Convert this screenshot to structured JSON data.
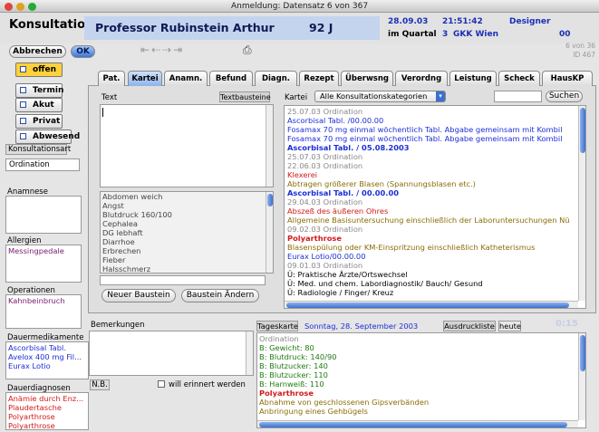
{
  "window": {
    "title": "Anmeldung: Datensatz 6 von 367"
  },
  "header": {
    "title": "Konsultation",
    "patient_name": "Professor Rubinstein Arthur",
    "age": "92 J",
    "date": "28.09.03",
    "time": "21:51:42",
    "user": "Designer",
    "quarter_label": "im Quartal",
    "quarter": "3",
    "insurance": "GKK Wien",
    "code": "00",
    "record_count": "6 von 36",
    "id_label": "ID 467"
  },
  "toolbar": {
    "cancel": "Abbrechen",
    "ok": "OK"
  },
  "sidebar": {
    "offen": "offen",
    "termin": "Termin",
    "akut": "Akut",
    "privat": "Privat",
    "abwesend": "Abwesend",
    "konsultationsart_label": "Konsultationsart",
    "konsultationsart_value": "Ordination"
  },
  "anamnese": {
    "label": "Anamnese"
  },
  "allergien": {
    "label": "Allergien",
    "items": [
      "Messingpedale"
    ]
  },
  "operationen": {
    "label": "Operationen",
    "items": [
      "Kahnbeinbruch"
    ]
  },
  "dauermedikamente": {
    "label": "Dauermedikamente",
    "items": [
      "Ascorbisal Tabl.",
      "Avelox 400 mg Fil...",
      "Eurax Lotio"
    ]
  },
  "dauerdiagnosen": {
    "label": "Dauerdiagnosen",
    "items": [
      "Anämie durch Enz...",
      "Plaudertasche",
      "Polyarthrose",
      "Polyarthrose"
    ]
  },
  "tabs": [
    "Pat.",
    "Kartei",
    "Anamn.",
    "Befund",
    "Diagn.",
    "Rezept",
    "Überwsng",
    "Verordng",
    "Leistung",
    "Scheck",
    "HausKP"
  ],
  "text_panel": {
    "label": "Text",
    "bausteine_button": "Textbausteine"
  },
  "bausteine": {
    "items": [
      "Abdomen weich",
      "Angst",
      "Blutdruck 160/100",
      "Cephalea",
      "DG lebhaft",
      "Diarrhoe",
      "Erbrechen",
      "Fieber",
      "Halsschmerz"
    ],
    "new_button": "Neuer Baustein",
    "change_button": "Baustein Ändern"
  },
  "kartei": {
    "label": "Kartei",
    "filter": "Alle Konsultationskategorien",
    "search_button": "Suchen",
    "entries": [
      {
        "text": "25.07.03  Ordination",
        "c": "gray",
        "b": false
      },
      {
        "text": "Ascorbisal Tabl. /00.00.00",
        "c": "blue",
        "b": false
      },
      {
        "text": "Fosamax 70 mg einmal wöchentlich Tabl. Abgabe gemeinsam mit Kombil",
        "c": "blue",
        "b": false
      },
      {
        "text": "Fosamax 70 mg einmal wöchentlich Tabl. Abgabe gemeinsam mit Kombil",
        "c": "blue",
        "b": false
      },
      {
        "text": "Ascorbisal Tabl. / 05.08.2003",
        "c": "blue",
        "b": true
      },
      {
        "text": "25.07.03  Ordination",
        "c": "gray",
        "b": false
      },
      {
        "text": "22.06.03  Ordination",
        "c": "gray",
        "b": false
      },
      {
        "text": "Klexerei",
        "c": "red",
        "b": false
      },
      {
        "text": "Abtragen größerer Blasen (Spannungsblasen etc.)",
        "c": "olive",
        "b": false
      },
      {
        "text": "Ascorbisal Tabl. / 00.00.00",
        "c": "blue",
        "b": true
      },
      {
        "text": "29.04.03  Ordination",
        "c": "gray",
        "b": false
      },
      {
        "text": "Abszeß des äußeren Ohres",
        "c": "red",
        "b": false
      },
      {
        "text": "Allgemeine Basisuntersuchung einschließlich der Laboruntersuchungen Nü",
        "c": "olive",
        "b": false
      },
      {
        "text": "09.02.03  Ordination",
        "c": "gray",
        "b": false
      },
      {
        "text": "Polyarthrose",
        "c": "red",
        "b": true
      },
      {
        "text": "Blasenspülung oder KM-Einspritzung einschließlich Katheterismus",
        "c": "olive",
        "b": false
      },
      {
        "text": "Eurax Lotio/00.00.00",
        "c": "blue",
        "b": false
      },
      {
        "text": "09.01.03  Ordination",
        "c": "gray",
        "b": false
      },
      {
        "text": "Ü: Praktische Ärzte/Ortswechsel",
        "c": "black",
        "b": false
      },
      {
        "text": "Ü: Med. und chem. Labordiagnostik/ Bauch/ Gesund",
        "c": "black",
        "b": false
      },
      {
        "text": "Ü: Radiologie / Finger/ Kreuz",
        "c": "black",
        "b": false
      }
    ]
  },
  "bemerkungen": {
    "label": "Bemerkungen",
    "nb_label": "N.B.",
    "remember_label": "will erinnert werden"
  },
  "tageskarte": {
    "label": "Tageskarte",
    "date": "Sonntag, 28. September 2003",
    "print_button": "Ausdruckliste",
    "today_button": "heute",
    "timer": "0:15",
    "entries": [
      {
        "text": "Ordination",
        "c": "gray",
        "b": false
      },
      {
        "text": "B: Gewicht: 80",
        "c": "green",
        "b": false
      },
      {
        "text": "B: Blutdruck: 140/90",
        "c": "green",
        "b": false
      },
      {
        "text": "B: Blutzucker: 140",
        "c": "green",
        "b": false
      },
      {
        "text": "B: Blutzucker: 110",
        "c": "green",
        "b": false
      },
      {
        "text": "B: Harnweiß: 110",
        "c": "green",
        "b": false
      },
      {
        "text": "Polyarthrose",
        "c": "red",
        "b": true
      },
      {
        "text": "Abnahme von geschlossenen Gipsverbänden",
        "c": "olive",
        "b": false
      },
      {
        "text": "Anbringung eines Gehbügels",
        "c": "olive",
        "b": false
      }
    ]
  },
  "colors": {
    "accent": "#3c6fd0",
    "patient_bg": "#c4d4ee",
    "offen_bg": "#ffd23a",
    "date_blue": "#1a2fb8"
  }
}
